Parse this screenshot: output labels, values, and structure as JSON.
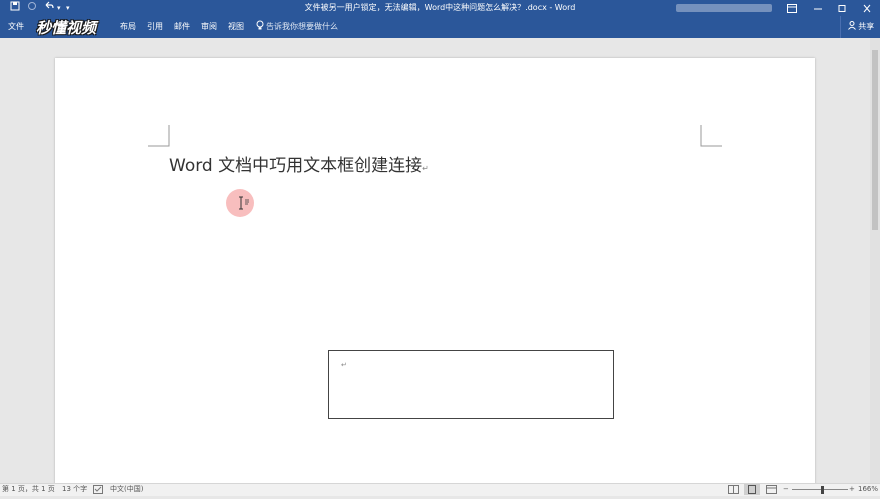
{
  "window": {
    "title": "文件被另一用户锁定，无法编辑，Word中这种问题怎么解决？.docx - Word"
  },
  "quick_access": {
    "save_icon": "save-icon",
    "undo_icon": "undo-icon",
    "redo_icon": "redo-icon"
  },
  "ribbon": {
    "tabs": [
      {
        "label": "文件"
      },
      {
        "label": "布局"
      },
      {
        "label": "引用"
      },
      {
        "label": "邮件"
      },
      {
        "label": "审阅"
      },
      {
        "label": "视图"
      }
    ],
    "tell_me": "告诉我你想要做什么",
    "share": "共享"
  },
  "watermark": {
    "logo_text": "秒懂视频"
  },
  "document": {
    "heading": "Word 文档中巧用文本框创建连接",
    "paragraph_mark": "↵"
  },
  "status": {
    "page": "第 1 页，共 1 页",
    "words": "13 个字",
    "language": "中文(中国)",
    "zoom": "166%"
  },
  "colors": {
    "accent": "#2b579a",
    "cursor_highlight": "#f06e6e"
  }
}
